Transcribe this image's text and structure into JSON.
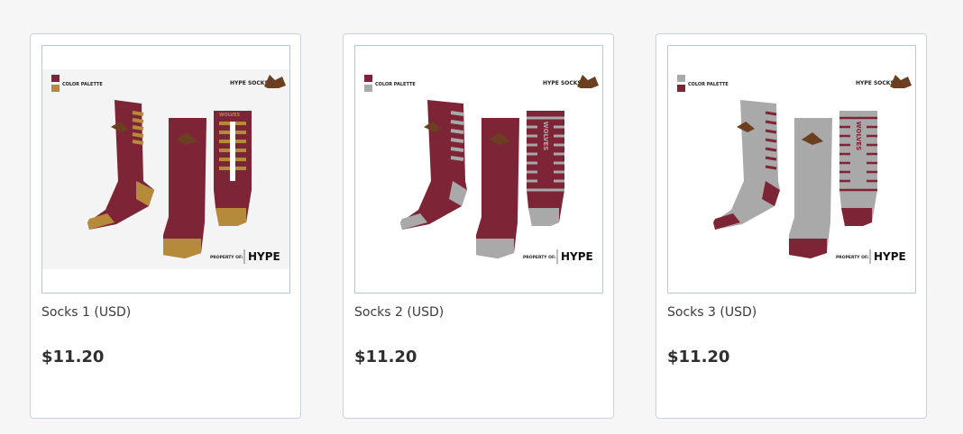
{
  "colors": {
    "maroon": "#7d2437",
    "gold": "#b58a3a",
    "gray": "#a9a9a9",
    "white": "#ffffff"
  },
  "artwork": {
    "palette_label": "COLOR PALETTE",
    "brand": "HYPE SOCKS",
    "property_label": "PROPERTY OF:",
    "logo_text": "HYPE",
    "team_word": "WOLVES"
  },
  "products": [
    {
      "name": "Socks 1 (USD)",
      "price": "$11.20",
      "palette": [
        "maroon",
        "gold"
      ]
    },
    {
      "name": "Socks 2 (USD)",
      "price": "$11.20",
      "palette": [
        "maroon",
        "gray"
      ]
    },
    {
      "name": "Socks 3 (USD)",
      "price": "$11.20",
      "palette": [
        "gray",
        "maroon"
      ]
    }
  ]
}
